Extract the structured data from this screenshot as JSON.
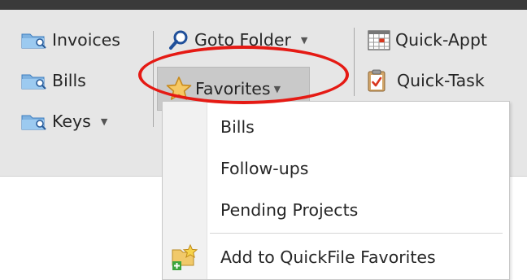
{
  "ribbon": {
    "group1": {
      "invoices_label": "Invoices",
      "bills_label": "Bills",
      "keys_label": "Keys"
    },
    "group2": {
      "goto_folder_label": "Goto Folder",
      "favorites_label": "Favorites"
    },
    "group3": {
      "quick_appt_label": "Quick-Appt",
      "quick_task_label": "Quick-Task"
    }
  },
  "favorites_menu": {
    "items": [
      {
        "label": "Bills"
      },
      {
        "label": "Follow-ups"
      },
      {
        "label": "Pending Projects"
      }
    ],
    "add_label": "Add to QuickFile Favorites"
  },
  "colors": {
    "annotation": "#e51a14",
    "ribbon_bg": "#e6e6e6",
    "highlight": "#c9c9c9"
  },
  "icons": {
    "folder": "folder-search-icon",
    "goto": "magnifier-icon",
    "favorites": "star-icon",
    "appt": "calendar-icon",
    "task": "clipboard-check-icon",
    "add_favorite": "folder-add-star-icon"
  }
}
